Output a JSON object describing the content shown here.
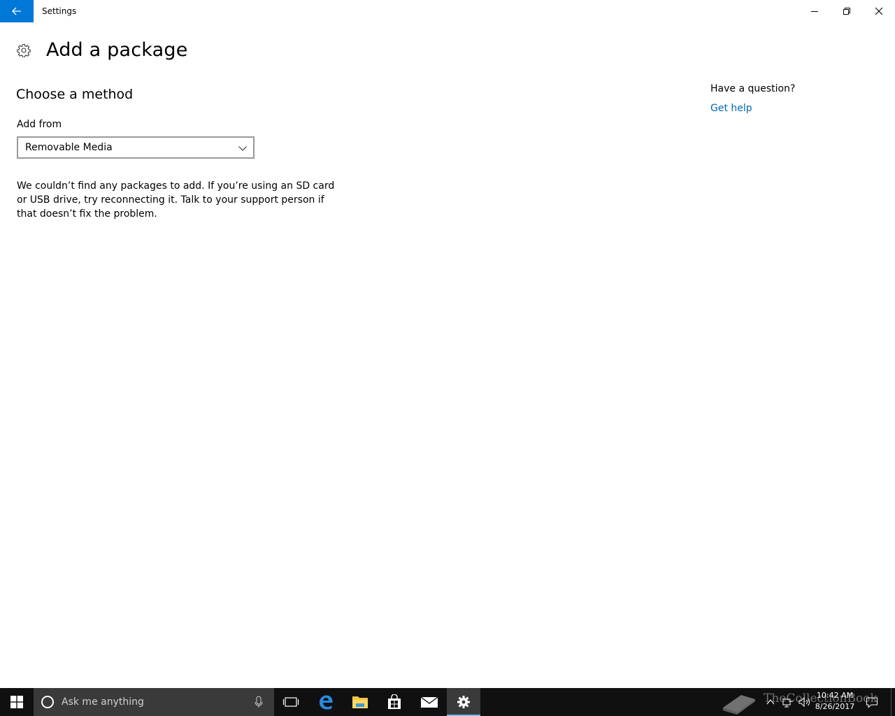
{
  "window": {
    "title": "Settings",
    "accent_color": "#0078d7"
  },
  "page": {
    "title": "Add a package",
    "header_icon": "gear-icon"
  },
  "main": {
    "section_heading": "Choose a method",
    "add_from_label": "Add from",
    "add_from_value": "Removable Media",
    "info_message": "We couldn’t find any packages to add. If you’re using an SD card or USB drive, try reconnecting it. Talk to your support person if that doesn’t fix the problem."
  },
  "help": {
    "question": "Have a question?",
    "link_label": "Get help",
    "link_color": "#0067b8"
  },
  "taskbar": {
    "search_placeholder": "Ask me anything",
    "pinned_apps": [
      "task-view-icon",
      "edge-icon",
      "file-explorer-icon",
      "store-icon",
      "mail-icon",
      "settings-icon"
    ],
    "active_app": "settings-icon",
    "clock_time": "10:42 AM",
    "clock_date": "8/26/2017"
  },
  "watermark": {
    "text": "TheCollectionBook"
  }
}
